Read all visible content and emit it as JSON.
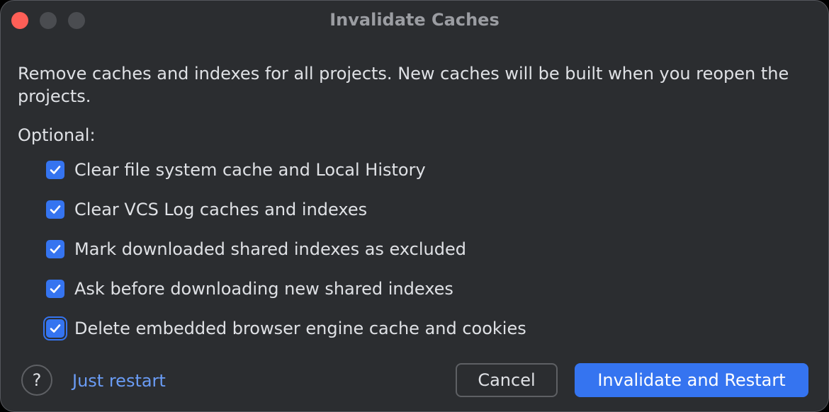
{
  "window": {
    "title": "Invalidate Caches"
  },
  "dialog": {
    "description": "Remove caches and indexes for all projects. New caches will be built when you reopen the projects.",
    "optional_label": "Optional:",
    "options": [
      {
        "label": "Clear file system cache and Local History",
        "checked": true
      },
      {
        "label": "Clear VCS Log caches and indexes",
        "checked": true
      },
      {
        "label": "Mark downloaded shared indexes as excluded",
        "checked": true
      },
      {
        "label": "Ask before downloading new shared indexes",
        "checked": true
      },
      {
        "label": "Delete embedded browser engine cache and cookies",
        "checked": true,
        "focused": true
      }
    ]
  },
  "footer": {
    "help_glyph": "?",
    "just_restart_label": "Just restart",
    "cancel_label": "Cancel",
    "primary_label": "Invalidate and Restart"
  },
  "colors": {
    "background": "#2b2d30",
    "accent": "#3574f0",
    "link": "#6a9cf5",
    "text": "#dfe1e5",
    "close": "#fe5f57"
  }
}
